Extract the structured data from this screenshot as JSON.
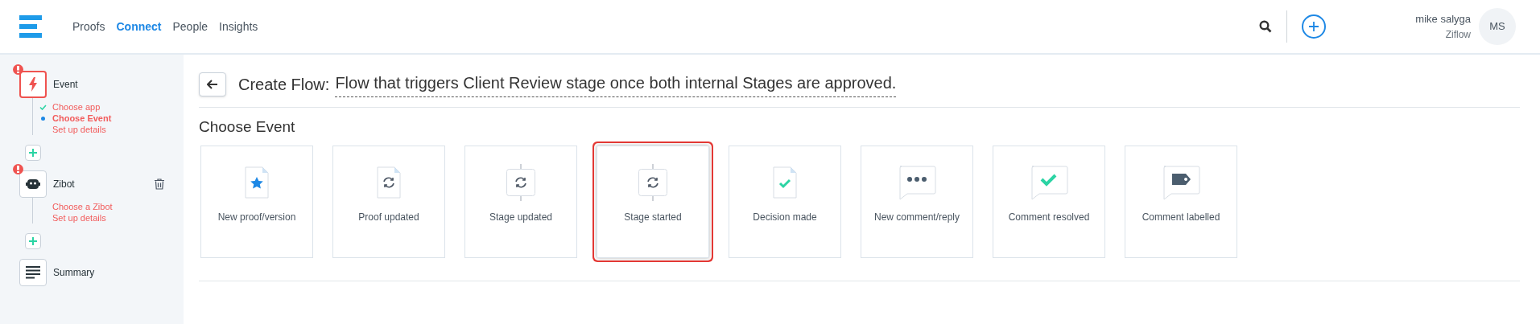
{
  "nav": [
    {
      "label": "Proofs",
      "selected": false
    },
    {
      "label": "Connect",
      "selected": true
    },
    {
      "label": "People",
      "selected": false
    },
    {
      "label": "Insights",
      "selected": false
    }
  ],
  "user": {
    "name": "mike salyga",
    "org": "Ziflow",
    "initials": "MS"
  },
  "steps": [
    {
      "label": "Event",
      "kind": "event",
      "error": true,
      "active": true,
      "deletable": false,
      "substeps": [
        {
          "label": "Choose app",
          "done": true,
          "current": false
        },
        {
          "label": "Choose Event",
          "done": false,
          "current": true
        },
        {
          "label": "Set up details",
          "done": false,
          "current": false
        }
      ]
    },
    {
      "label": "Zibot",
      "kind": "zibot",
      "error": true,
      "active": false,
      "deletable": true,
      "substeps": [
        {
          "label": "Choose a Zibot",
          "done": false,
          "current": false
        },
        {
          "label": "Set up details",
          "done": false,
          "current": false
        }
      ]
    },
    {
      "label": "Summary",
      "kind": "summary",
      "error": false,
      "active": false,
      "deletable": false
    }
  ],
  "title": {
    "prefix": "Create Flow:",
    "name": "Flow that triggers Client Review stage once both internal Stages are approved."
  },
  "section": "Choose Event",
  "events": [
    {
      "label": "New proof/version",
      "kind": "doc-star",
      "selected": false
    },
    {
      "label": "Proof updated",
      "kind": "doc-sync",
      "selected": false
    },
    {
      "label": "Stage updated",
      "kind": "stage-sync",
      "selected": false
    },
    {
      "label": "Stage started",
      "kind": "stage-sync",
      "selected": true
    },
    {
      "label": "Decision made",
      "kind": "doc-check",
      "selected": false
    },
    {
      "label": "New comment/reply",
      "kind": "bubble-dots",
      "selected": false
    },
    {
      "label": "Comment resolved",
      "kind": "bubble-check",
      "selected": false
    },
    {
      "label": "Comment labelled",
      "kind": "bubble-tag",
      "selected": false
    }
  ]
}
